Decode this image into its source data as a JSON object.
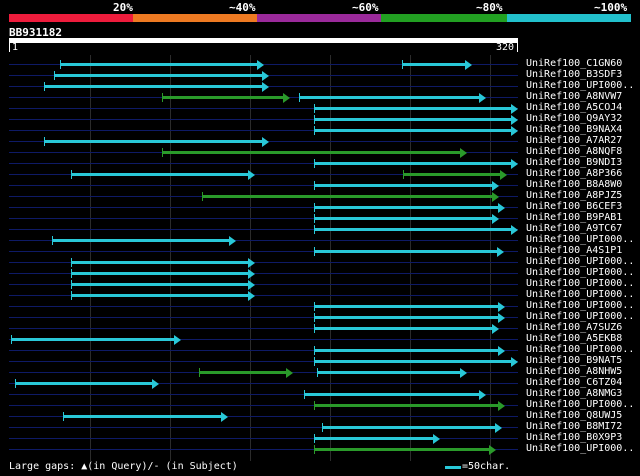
{
  "scale": {
    "ticks": [
      "20%",
      "~40%",
      "~60%",
      "~80%",
      "~100%"
    ],
    "colors": [
      "#ee1c3c",
      "#ee7a22",
      "#9b2a9b",
      "#22a022",
      "#22c0cc"
    ]
  },
  "query": {
    "id": "BB931182",
    "start": "1",
    "end": "320"
  },
  "hit_colors": {
    "cyan": "#29c8d8",
    "green": "#2a9a2a"
  },
  "hits": [
    {
      "label": "UniRef100_C1GN60",
      "segments": [
        {
          "from": 33,
          "to": 161,
          "color": "cyan"
        },
        {
          "from": 247,
          "to": 291,
          "color": "cyan"
        }
      ]
    },
    {
      "label": "UniRef100_B3SDF3",
      "segments": [
        {
          "from": 29,
          "to": 164,
          "color": "cyan"
        }
      ]
    },
    {
      "label": "UniRef100_UPI000..",
      "segments": [
        {
          "from": 23,
          "to": 164,
          "color": "cyan"
        }
      ]
    },
    {
      "label": "UniRef100_A8NVW7",
      "segments": [
        {
          "from": 97,
          "to": 177,
          "color": "green"
        },
        {
          "from": 183,
          "to": 300,
          "color": "cyan"
        }
      ]
    },
    {
      "label": "UniRef100_A5COJ4",
      "segments": [
        {
          "from": 192,
          "to": 320,
          "color": "cyan"
        }
      ]
    },
    {
      "label": "UniRef100_Q9AY32",
      "segments": [
        {
          "from": 192,
          "to": 320,
          "color": "cyan"
        }
      ]
    },
    {
      "label": "UniRef100_B9NAX4",
      "segments": [
        {
          "from": 192,
          "to": 320,
          "color": "cyan"
        }
      ]
    },
    {
      "label": "UniRef100_A7AR27",
      "segments": [
        {
          "from": 23,
          "to": 164,
          "color": "cyan"
        }
      ]
    },
    {
      "label": "UniRef100_A8NQF8",
      "segments": [
        {
          "from": 97,
          "to": 288,
          "color": "green"
        }
      ]
    },
    {
      "label": "UniRef100_B9NDI3",
      "segments": [
        {
          "from": 192,
          "to": 320,
          "color": "cyan"
        }
      ]
    },
    {
      "label": "UniRef100_A8P366",
      "segments": [
        {
          "from": 40,
          "to": 155,
          "color": "cyan"
        },
        {
          "from": 248,
          "to": 313,
          "color": "green"
        }
      ]
    },
    {
      "label": "UniRef100_B8A8W0",
      "segments": [
        {
          "from": 192,
          "to": 308,
          "color": "cyan"
        }
      ]
    },
    {
      "label": "UniRef100_A8PJZ5",
      "segments": [
        {
          "from": 122,
          "to": 308,
          "color": "green"
        }
      ]
    },
    {
      "label": "UniRef100_B6CEF3",
      "segments": [
        {
          "from": 192,
          "to": 312,
          "color": "cyan"
        }
      ]
    },
    {
      "label": "UniRef100_B9PAB1",
      "segments": [
        {
          "from": 192,
          "to": 308,
          "color": "cyan"
        }
      ]
    },
    {
      "label": "UniRef100_A9TC67",
      "segments": [
        {
          "from": 192,
          "to": 320,
          "color": "cyan"
        }
      ]
    },
    {
      "label": "UniRef100_UPI000..",
      "segments": [
        {
          "from": 28,
          "to": 143,
          "color": "cyan"
        }
      ]
    },
    {
      "label": "UniRef100_A4S1P1",
      "segments": [
        {
          "from": 192,
          "to": 311,
          "color": "cyan"
        }
      ]
    },
    {
      "label": "UniRef100_UPI000..",
      "segments": [
        {
          "from": 40,
          "to": 155,
          "color": "cyan"
        }
      ]
    },
    {
      "label": "UniRef100_UPI000..",
      "segments": [
        {
          "from": 40,
          "to": 155,
          "color": "cyan"
        }
      ]
    },
    {
      "label": "UniRef100_UPI000..",
      "segments": [
        {
          "from": 40,
          "to": 155,
          "color": "cyan"
        }
      ]
    },
    {
      "label": "UniRef100_UPI000..",
      "segments": [
        {
          "from": 40,
          "to": 155,
          "color": "cyan"
        }
      ]
    },
    {
      "label": "UniRef100_UPI000..",
      "segments": [
        {
          "from": 192,
          "to": 312,
          "color": "cyan"
        }
      ]
    },
    {
      "label": "UniRef100_UPI000..",
      "segments": [
        {
          "from": 192,
          "to": 312,
          "color": "cyan"
        }
      ]
    },
    {
      "label": "UniRef100_A7SUZ6",
      "segments": [
        {
          "from": 192,
          "to": 308,
          "color": "cyan"
        }
      ]
    },
    {
      "label": "UniRef100_A5EKB8",
      "segments": [
        {
          "from": 2,
          "to": 109,
          "color": "cyan"
        }
      ]
    },
    {
      "label": "UniRef100_UPI000..",
      "segments": [
        {
          "from": 192,
          "to": 312,
          "color": "cyan"
        }
      ]
    },
    {
      "label": "UniRef100_B9NAT5",
      "segments": [
        {
          "from": 192,
          "to": 320,
          "color": "cyan"
        }
      ]
    },
    {
      "label": "UniRef100_A8NHW5",
      "segments": [
        {
          "from": 120,
          "to": 179,
          "color": "green"
        },
        {
          "from": 194,
          "to": 288,
          "color": "cyan"
        }
      ]
    },
    {
      "label": "UniRef100_C6TZ04",
      "segments": [
        {
          "from": 5,
          "to": 95,
          "color": "cyan"
        }
      ]
    },
    {
      "label": "UniRef100_A8NMG3",
      "segments": [
        {
          "from": 186,
          "to": 300,
          "color": "cyan"
        }
      ]
    },
    {
      "label": "UniRef100_UPI000..",
      "segments": [
        {
          "from": 192,
          "to": 312,
          "color": "green"
        }
      ]
    },
    {
      "label": "UniRef100_Q8UWJ5",
      "segments": [
        {
          "from": 35,
          "to": 138,
          "color": "cyan"
        }
      ]
    },
    {
      "label": "UniRef100_B8MI72",
      "segments": [
        {
          "from": 197,
          "to": 310,
          "color": "cyan"
        }
      ]
    },
    {
      "label": "UniRef100_B0X9P3",
      "segments": [
        {
          "from": 192,
          "to": 271,
          "color": "cyan"
        }
      ]
    },
    {
      "label": "UniRef100_UPI000..",
      "segments": [
        {
          "from": 192,
          "to": 306,
          "color": "green"
        }
      ]
    }
  ],
  "footer": {
    "gaps_text": "Large gaps: ▲(in Query)/- (in Subject)",
    "legend_text": "=50char."
  }
}
